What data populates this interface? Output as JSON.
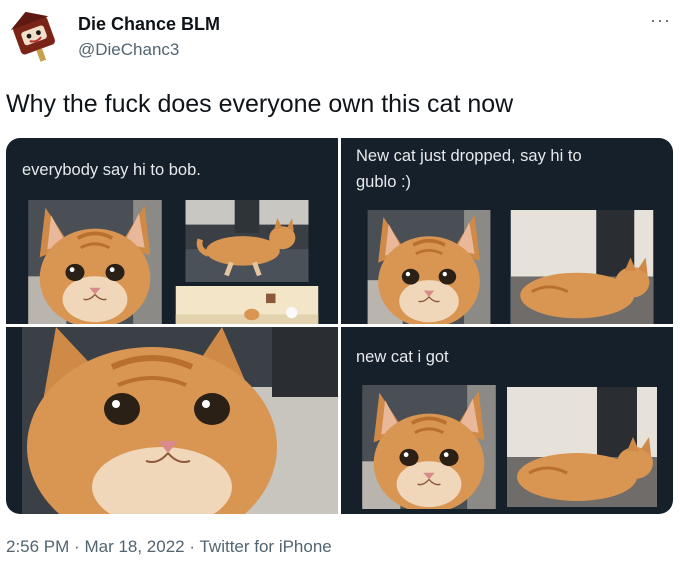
{
  "author": {
    "display_name": "Die Chance BLM",
    "handle": "@DieChanc3"
  },
  "more_label": "···",
  "tweet_text": "Why the fuck does everyone own this cat now",
  "media": {
    "panels": [
      {
        "caption": "everybody say hi to bob."
      },
      {
        "caption": "New cat just dropped, say hi to gublo :)"
      },
      {
        "caption": ""
      },
      {
        "caption": "new cat i got"
      }
    ]
  },
  "footer": {
    "time": "2:56 PM",
    "separator": "·",
    "date": "Mar 18, 2022",
    "source": "Twitter for iPhone"
  },
  "colors": {
    "panel_bg": "#15202b",
    "secondary_text": "#536471",
    "cat_orange": "#d9954f"
  }
}
